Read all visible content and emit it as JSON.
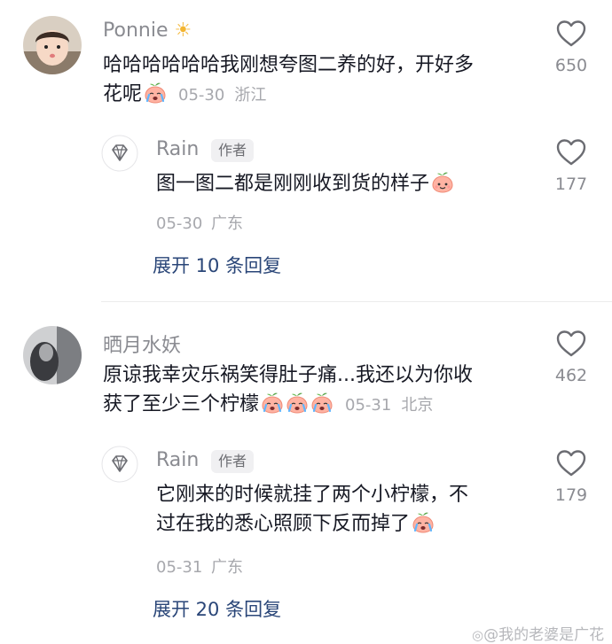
{
  "comments": [
    {
      "author": "Ponnie",
      "text_line1": "哈哈哈哈哈哈我刚想夸图二养的好，开好多",
      "text_line2": "花呢",
      "date": "05-30",
      "location": "浙江",
      "likes": "650",
      "reply": {
        "author": "Rain",
        "badge": "作者",
        "text_line1": "图一图二都是刚刚收到货的样子",
        "date": "05-30",
        "location": "广东",
        "likes": "177"
      },
      "expand_label": "展开 10 条回复"
    },
    {
      "author": "晒月水妖",
      "text_line1": "原谅我幸灾乐祸笑得肚子痛...我还以为你收",
      "text_line2": "获了至少三个柠檬",
      "date": "05-31",
      "location": "北京",
      "likes": "462",
      "reply": {
        "author": "Rain",
        "badge": "作者",
        "text_line1": "它刚来的时候就挂了两个小柠檬，不",
        "text_line2": "过在我的悉心照顾下反而掉了",
        "date": "05-31",
        "location": "广东",
        "likes": "179"
      },
      "expand_label": "展开 20 条回复"
    }
  ],
  "watermark": "@我的老婆是广花",
  "colors": {
    "link": "#2a4678",
    "muted": "#8a8b91",
    "text": "#161823"
  }
}
